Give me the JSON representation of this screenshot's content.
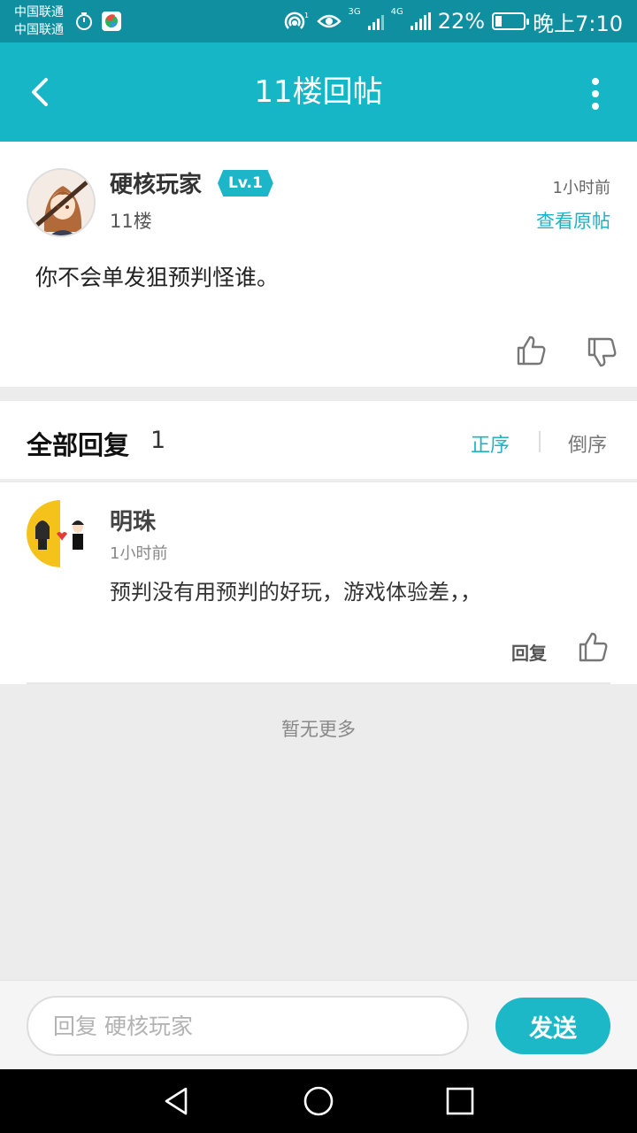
{
  "status_bar": {
    "carrier_1": "中国联通",
    "carrier_2": "中国联通",
    "net_3g": "3G",
    "net_4g": "4G",
    "battery_text": "22%",
    "battery_level": 0.22,
    "time": "晚上7:10"
  },
  "header": {
    "title": "11楼回帖"
  },
  "post": {
    "author": "硬核玩家",
    "level": "Lv.1",
    "floor": "11楼",
    "time": "1小时前",
    "view_original": "查看原帖",
    "content": "你不会单发狙预判怪谁。"
  },
  "replies_header": {
    "label": "全部回复",
    "count": "1",
    "sort_asc": "正序",
    "sort_desc": "倒序"
  },
  "replies": [
    {
      "author": "明珠",
      "time": "1小时前",
      "content": "预判没有用预判的好玩，游戏体验差，，",
      "reply_label": "回复"
    }
  ],
  "no_more": "暂无更多",
  "composer": {
    "placeholder": "回复 硬核玩家",
    "send_label": "发送"
  },
  "colors": {
    "accent": "#16b6c6",
    "status_bar": "#0f8fa0"
  }
}
